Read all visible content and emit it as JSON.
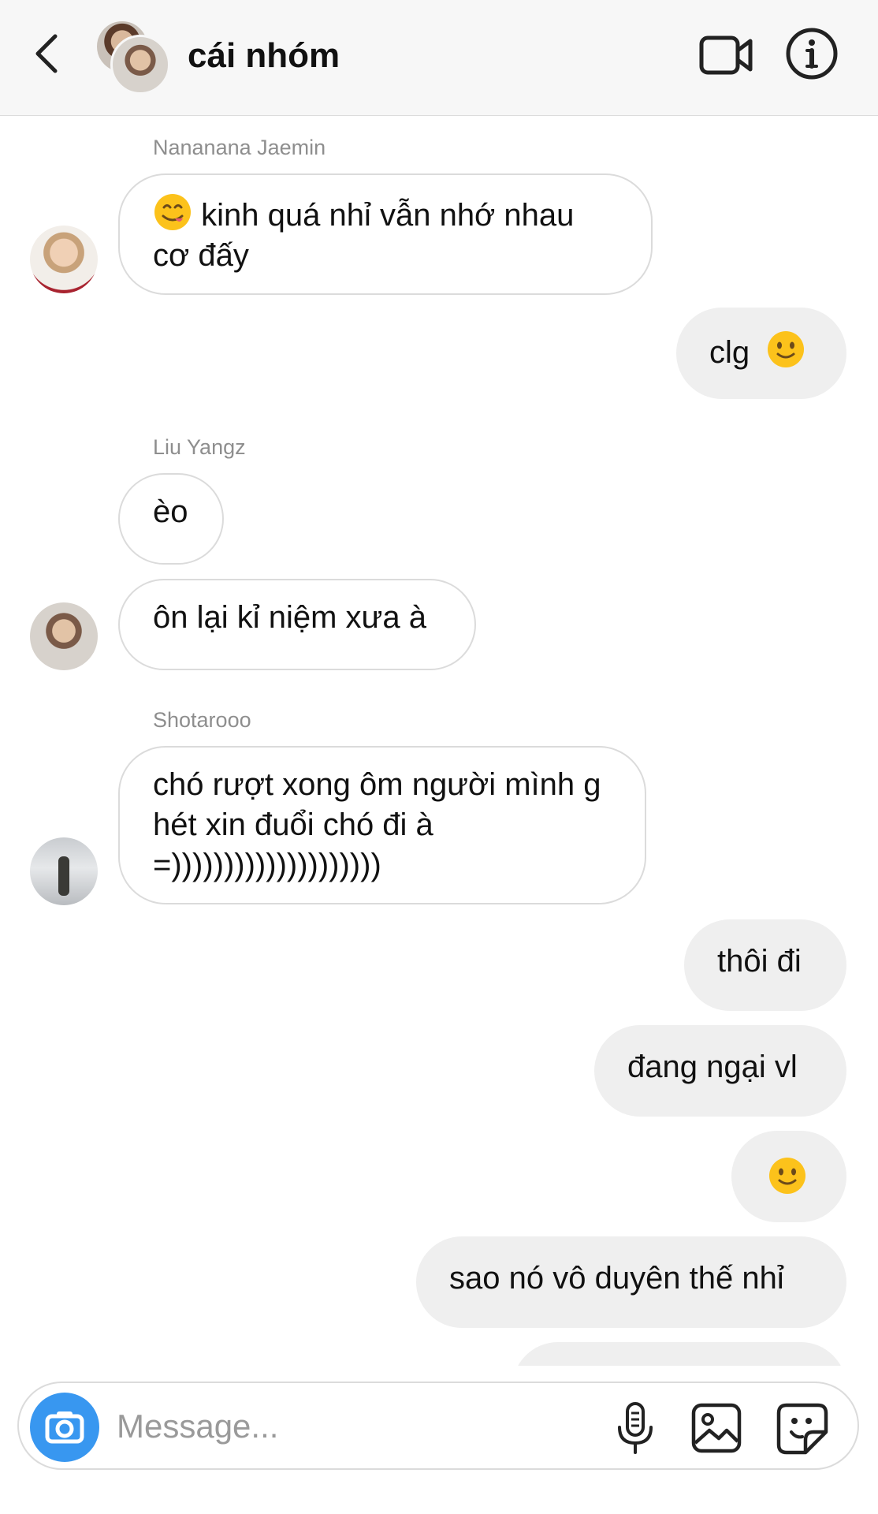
{
  "header": {
    "title": "cái nhóm"
  },
  "messages": [
    {
      "sender": "Nananana Jaemin",
      "text": "kinh quá nhỉ vẫn nhớ nhau cơ đấy"
    },
    {
      "text": "clg"
    },
    {
      "sender": "Liu Yangz",
      "text1": "èo",
      "text2": "ôn lại kỉ niệm xưa à"
    },
    {
      "sender": "Shotarooo",
      "text": "chó rượt xong ôm người mình ghét xin đuổi chó đi à =))))))))))))))))))))"
    },
    {
      "text": "thôi đi"
    },
    {
      "text": "đang ngại vl"
    },
    {
      "text": "sao nó vô duyên thế nhỉ"
    }
  ],
  "input": {
    "placeholder": "Message..."
  },
  "icons": {
    "back": "chevron-left-icon",
    "video": "video-camera-icon",
    "info": "info-icon",
    "camera": "camera-icon",
    "mic": "microphone-icon",
    "gallery": "image-gallery-icon",
    "sticker": "sticker-icon",
    "emoji_yum": "face-savoring-food-emoji",
    "emoji_smile": "slightly-smiling-face-emoji"
  },
  "colors": {
    "accent": "#3897f0",
    "incoming_border": "#dbdbdb",
    "outgoing_bg": "#efefef",
    "sender_name": "#8e8e8e"
  }
}
